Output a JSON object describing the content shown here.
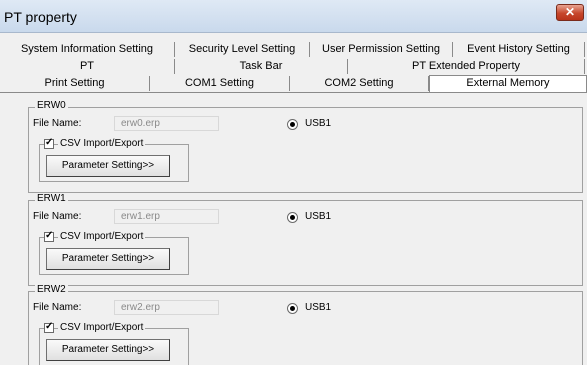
{
  "window": {
    "title": "PT property",
    "close_glyph": "✕"
  },
  "tabs": {
    "row1": [
      "System Information Setting",
      "Security Level Setting",
      "User Permission Setting",
      "Event History Setting"
    ],
    "row2": [
      "PT",
      "Task Bar",
      "PT Extended Property"
    ],
    "row3": [
      "Print Setting",
      "COM1 Setting",
      "COM2 Setting",
      "External Memory"
    ],
    "active": "External Memory"
  },
  "groups": [
    {
      "title": "ERW0",
      "file_label": "File Name:",
      "file_name": "erw0.erp",
      "radio_label": "USB1",
      "checkbox_label": "CSV Import/Export",
      "checked_glyph": "✓",
      "button_label": "Parameter Setting>>"
    },
    {
      "title": "ERW1",
      "file_label": "File Name:",
      "file_name": "erw1.erp",
      "radio_label": "USB1",
      "checkbox_label": "CSV Import/Export",
      "checked_glyph": "✓",
      "button_label": "Parameter Setting>>"
    },
    {
      "title": "ERW2",
      "file_label": "File Name:",
      "file_name": "erw2.erp",
      "radio_label": "USB1",
      "checkbox_label": "CSV Import/Export",
      "checked_glyph": "✓",
      "button_label": "Parameter Setting>>"
    }
  ],
  "icons": {
    "close": "close-icon",
    "checkbox": "check-icon",
    "radio": "radio-dot-icon"
  }
}
